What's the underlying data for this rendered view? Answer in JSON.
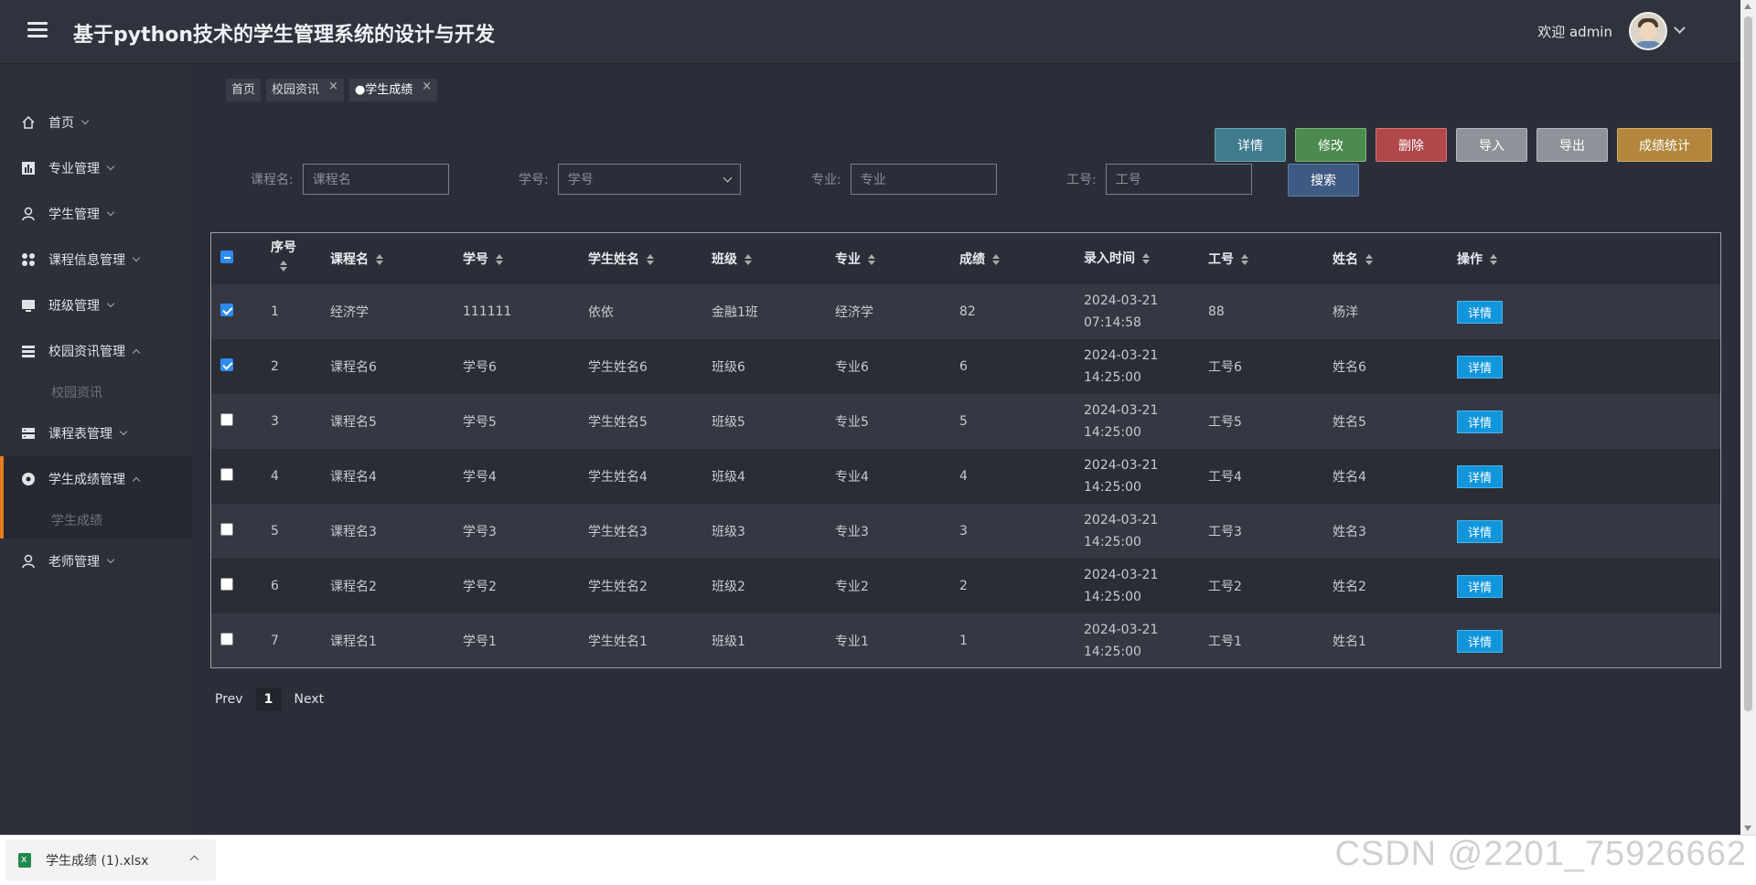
{
  "header": {
    "title": "基于python技术的学生管理系统的设计与开发",
    "welcome": "欢迎 admin"
  },
  "sidebar": {
    "items": [
      {
        "label": "首页",
        "icon": "home-icon"
      },
      {
        "label": "专业管理",
        "icon": "chart-icon"
      },
      {
        "label": "学生管理",
        "icon": "user-icon"
      },
      {
        "label": "课程信息管理",
        "icon": "grid-icon"
      },
      {
        "label": "班级管理",
        "icon": "monitor-icon"
      },
      {
        "label": "校园资讯管理",
        "icon": "list-icon",
        "sub": "校园资讯"
      },
      {
        "label": "课程表管理",
        "icon": "list-icon"
      },
      {
        "label": "学生成绩管理",
        "icon": "target-icon",
        "sub": "学生成绩"
      },
      {
        "label": "老师管理",
        "icon": "user-icon"
      }
    ]
  },
  "tabs": [
    {
      "label": "首页"
    },
    {
      "label": "校园资讯",
      "close": "×"
    },
    {
      "label": "●学生成绩",
      "close": "×"
    }
  ],
  "toolbar": {
    "detail": "详情",
    "edit": "修改",
    "delete": "删除",
    "import": "导入",
    "export": "导出",
    "stats": "成绩统计"
  },
  "search": {
    "course_label": "课程名:",
    "course_placeholder": "课程名",
    "sid_label": "学号:",
    "sid_placeholder": "学号",
    "major_label": "专业:",
    "major_placeholder": "专业",
    "tno_label": "工号:",
    "tno_placeholder": "工号",
    "button": "搜索"
  },
  "table": {
    "headers": {
      "idx_line1": "序号",
      "course": "课程名",
      "sid": "学号",
      "sname": "学生姓名",
      "class": "班级",
      "major": "专业",
      "score": "成绩",
      "time": "录入时间",
      "tno": "工号",
      "tname": "姓名",
      "op": "操作"
    },
    "op_label": "详情",
    "rows": [
      {
        "idx": "1",
        "course": "经济学",
        "sid": "111111",
        "sname": "依依",
        "class": "金融1班",
        "major": "经济学",
        "score": "82",
        "time": "2024-03-21 07:14:58",
        "tno": "88",
        "tname": "杨洋",
        "checked": true
      },
      {
        "idx": "2",
        "course": "课程名6",
        "sid": "学号6",
        "sname": "学生姓名6",
        "class": "班级6",
        "major": "专业6",
        "score": "6",
        "time": "2024-03-21 14:25:00",
        "tno": "工号6",
        "tname": "姓名6",
        "checked": true
      },
      {
        "idx": "3",
        "course": "课程名5",
        "sid": "学号5",
        "sname": "学生姓名5",
        "class": "班级5",
        "major": "专业5",
        "score": "5",
        "time": "2024-03-21 14:25:00",
        "tno": "工号5",
        "tname": "姓名5",
        "checked": false
      },
      {
        "idx": "4",
        "course": "课程名4",
        "sid": "学号4",
        "sname": "学生姓名4",
        "class": "班级4",
        "major": "专业4",
        "score": "4",
        "time": "2024-03-21 14:25:00",
        "tno": "工号4",
        "tname": "姓名4",
        "checked": false
      },
      {
        "idx": "5",
        "course": "课程名3",
        "sid": "学号3",
        "sname": "学生姓名3",
        "class": "班级3",
        "major": "专业3",
        "score": "3",
        "time": "2024-03-21 14:25:00",
        "tno": "工号3",
        "tname": "姓名3",
        "checked": false
      },
      {
        "idx": "6",
        "course": "课程名2",
        "sid": "学号2",
        "sname": "学生姓名2",
        "class": "班级2",
        "major": "专业2",
        "score": "2",
        "time": "2024-03-21 14:25:00",
        "tno": "工号2",
        "tname": "姓名2",
        "checked": false
      },
      {
        "idx": "7",
        "course": "课程名1",
        "sid": "学号1",
        "sname": "学生姓名1",
        "class": "班级1",
        "major": "专业1",
        "score": "1",
        "time": "2024-03-21 14:25:00",
        "tno": "工号1",
        "tname": "姓名1",
        "checked": false
      }
    ]
  },
  "pagination": {
    "prev": "Prev",
    "current": "1",
    "next": "Next"
  },
  "download": {
    "filename": "学生成绩 (1).xlsx"
  },
  "watermark": "CSDN @2201_75926662",
  "colors": {
    "accent": "#e77c1e",
    "op_button": "#1296db",
    "checkbox": "#2d8cf0"
  }
}
